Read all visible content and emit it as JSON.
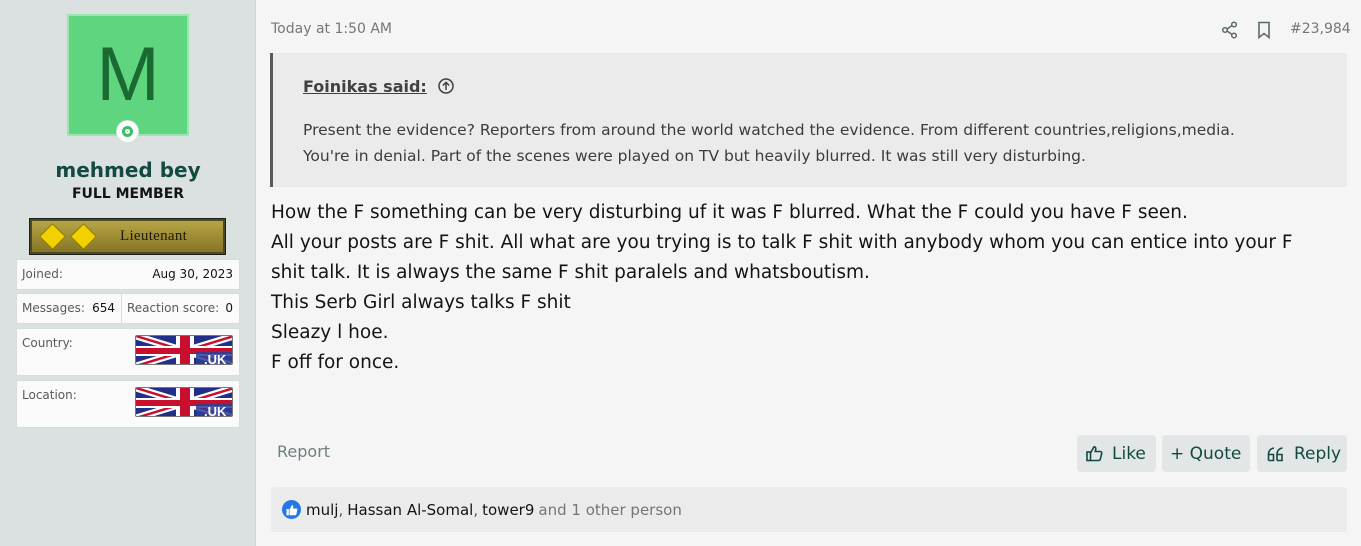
{
  "user": {
    "avatar_letter": "M",
    "username": "mehmed bey",
    "title": "FULL MEMBER",
    "rank_label": "Lieutenant",
    "joined_label": "Joined:",
    "joined_value": "Aug 30, 2023",
    "messages_label": "Messages:",
    "messages_value": "654",
    "reaction_label": "Reaction score:",
    "reaction_value": "0",
    "country_label": "Country:",
    "location_label": "Location:",
    "flag_text": ".UK",
    "avatar_color": "#5ed57e",
    "status": "online"
  },
  "post": {
    "date": "Today at 1:50 AM",
    "number": "#23,984",
    "quote": {
      "author": "Foinikas said:",
      "lines": [
        "Present the evidence? Reporters from around the world watched the evidence. From different countries,religions,media.",
        "You're in denial. Part of the scenes were played on TV but heavily blurred. It was still very disturbing."
      ]
    },
    "message_lines": [
      "How the F something can be very disturbing uf it was F blurred. What the F could you have F seen.",
      "All your posts are F shit. All what are you trying is to talk F shit with anybody whom you can entice into your F",
      "shit talk. It is always the same F shit paralels and whatsboutism.",
      "This Serb Girl always talks F shit",
      "Sleazy l hoe.",
      "F off for once."
    ]
  },
  "actions": {
    "report": "Report",
    "like": "Like",
    "quote": "+ Quote",
    "reply": "Reply"
  },
  "reactions": {
    "users": [
      "mulj",
      "Hassan Al-Somal",
      "tower9"
    ],
    "separator": ",",
    "others": "and 1 other person",
    "badge_color": "#2577e8"
  },
  "icons": [
    "share-icon",
    "bookmark-icon",
    "arrow-up-circle-icon",
    "thumbs-up-icon",
    "reply-quote-icon",
    "like-reaction-icon"
  ]
}
